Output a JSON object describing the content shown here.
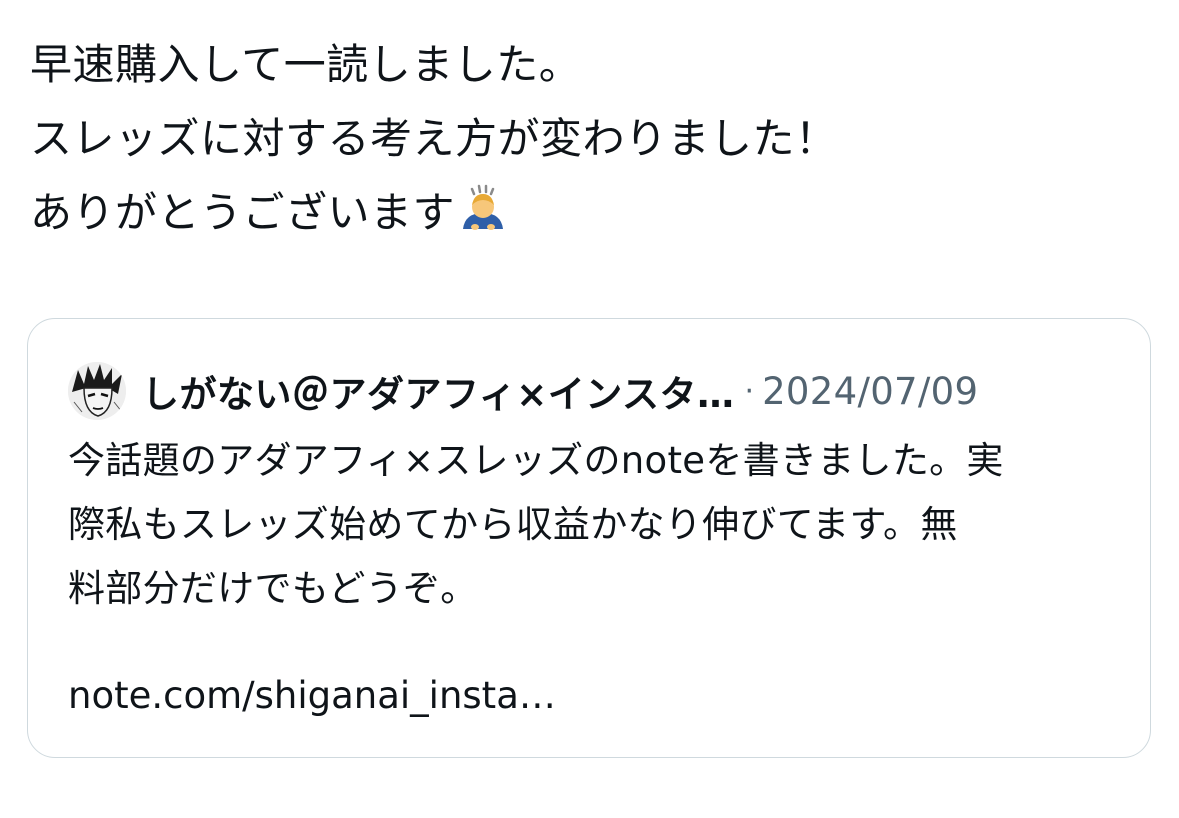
{
  "post": {
    "lines": [
      "早速購入して一読しました。",
      "スレッズに対する考え方が変わりました！",
      "ありがとうございます"
    ],
    "emoji_icon": "bowing-person-emoji"
  },
  "quoted_post": {
    "author_name": "しがない＠アダアフィ×インスタ…",
    "separator": "·",
    "date": "2024/07/09",
    "text_lines": [
      "今話題のアダアフィ×スレッズのnoteを書きました。実",
      "際私もスレッズ始めてから収益かなり伸びてます。無",
      "料部分だけでもどうぞ。"
    ],
    "link": "note.com/shiganai_insta…",
    "avatar_icon": "manga-character-avatar"
  },
  "colors": {
    "text_primary": "#0f1419",
    "text_secondary": "#536471",
    "card_border": "#cfd9de",
    "background": "#ffffff"
  }
}
